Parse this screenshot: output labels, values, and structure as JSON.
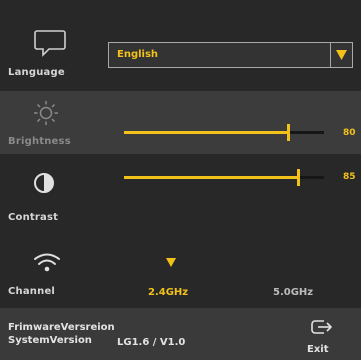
{
  "language": {
    "label": "Language",
    "icon": "speech-bubble-icon",
    "selected": "English"
  },
  "brightness": {
    "label": "Brightness",
    "icon": "sun-icon",
    "value": "80",
    "level": 0.82
  },
  "contrast": {
    "label": "Contrast",
    "icon": "contrast-icon",
    "value": "85",
    "level": 0.87
  },
  "channel": {
    "label": "Channel",
    "icon": "wifi-icon",
    "options": [
      "2.4GHz",
      "5.0GHz"
    ],
    "selected": "2.4GHz"
  },
  "footer": {
    "firmware_label": "FrimwareVersreion",
    "system_label": "SystemVersion",
    "system_value": "LG1.6 / V1.0",
    "exit_label": "Exit",
    "exit_icon": "exit-icon"
  },
  "colors": {
    "accent": "#f2c21b",
    "background": "#272727",
    "highlight_row": "#3c3c3c",
    "footer": "#3a3a3a"
  }
}
